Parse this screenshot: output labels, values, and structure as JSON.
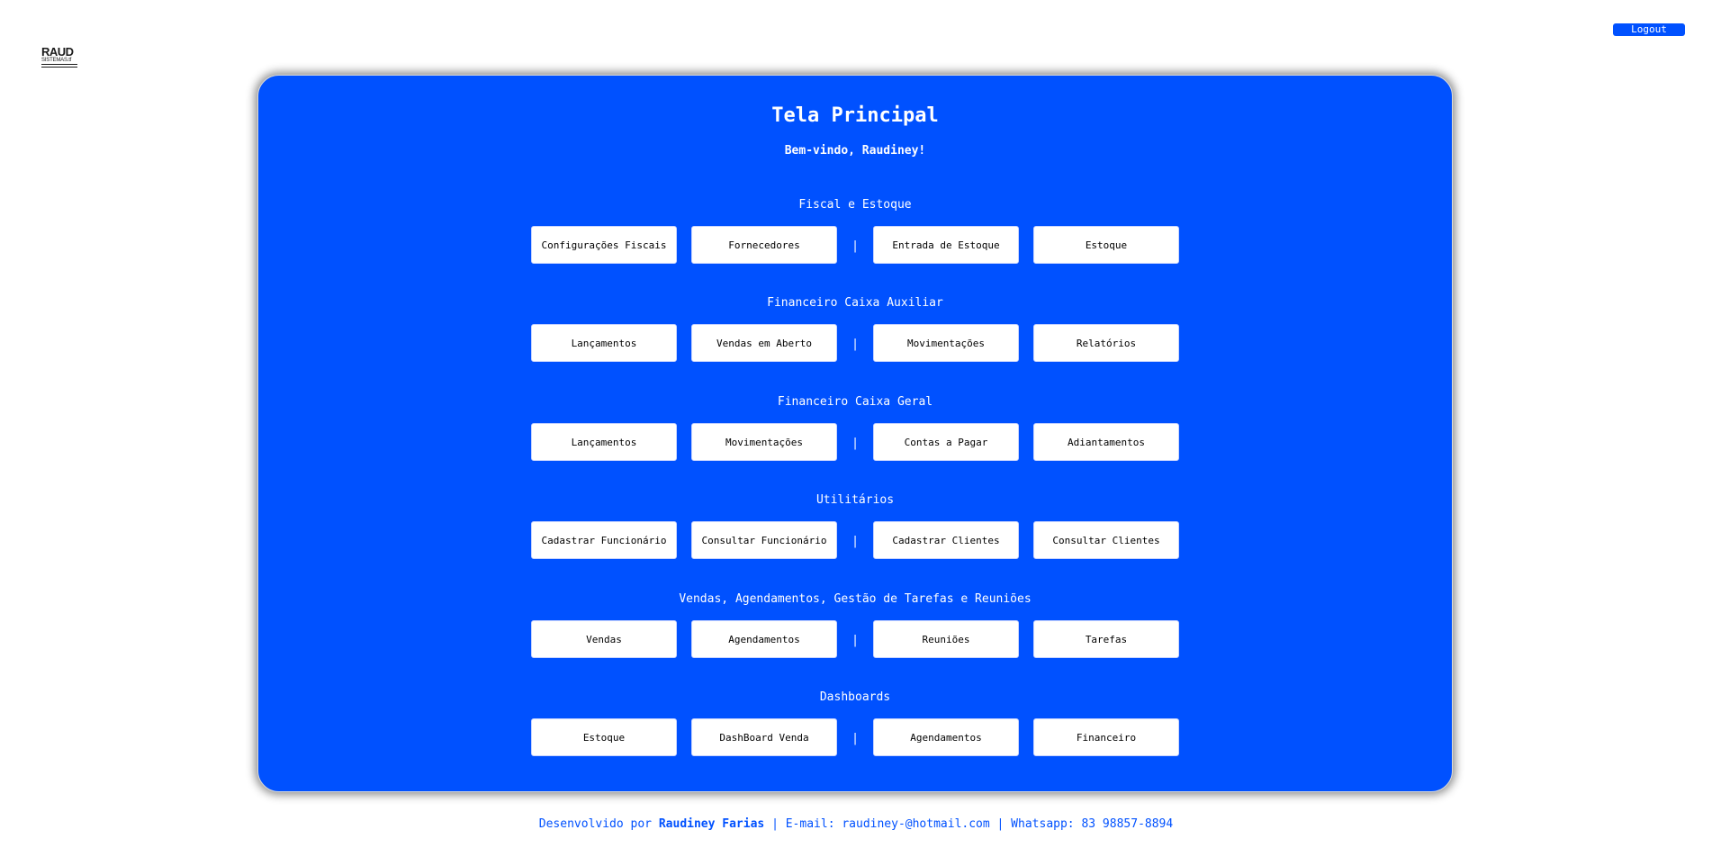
{
  "logo": {
    "main": "RAUD",
    "sub": "SISTEMAS.tf"
  },
  "header": {
    "logout_label": "Logout"
  },
  "main": {
    "title": "Tela Principal",
    "welcome": "Bem-vindo, Raudiney!",
    "separator": "|",
    "sections": [
      {
        "title": "Fiscal e Estoque",
        "buttons": [
          "Configurações Fiscais",
          "Fornecedores",
          "Entrada de Estoque",
          "Estoque"
        ]
      },
      {
        "title": "Financeiro Caixa Auxiliar",
        "buttons": [
          "Lançamentos",
          "Vendas em Aberto",
          "Movimentações",
          "Relatórios"
        ]
      },
      {
        "title": "Financeiro Caixa Geral",
        "buttons": [
          "Lançamentos",
          "Movimentações",
          "Contas a Pagar",
          "Adiantamentos"
        ]
      },
      {
        "title": "Utilitários",
        "buttons": [
          "Cadastrar Funcionário",
          "Consultar Funcionário",
          "Cadastrar Clientes",
          "Consultar Clientes"
        ]
      },
      {
        "title": "Vendas, Agendamentos, Gestão de Tarefas e Reuniões",
        "buttons": [
          "Vendas",
          "Agendamentos",
          "Reuniões",
          "Tarefas"
        ]
      },
      {
        "title": "Dashboards",
        "buttons": [
          "Estoque",
          "DashBoard Venda",
          "Agendamentos",
          "Financeiro"
        ]
      }
    ]
  },
  "footer": {
    "prefix": "Desenvolvido por ",
    "author": "Raudiney Farias",
    "contact": " | E-mail: raudiney-@hotmail.com | Whatsapp: 83 98857-8894"
  },
  "colors": {
    "accent": "#0051ff",
    "background": "#ffffff",
    "button_bg": "#ffffff",
    "text_on_accent": "#ffffff"
  }
}
